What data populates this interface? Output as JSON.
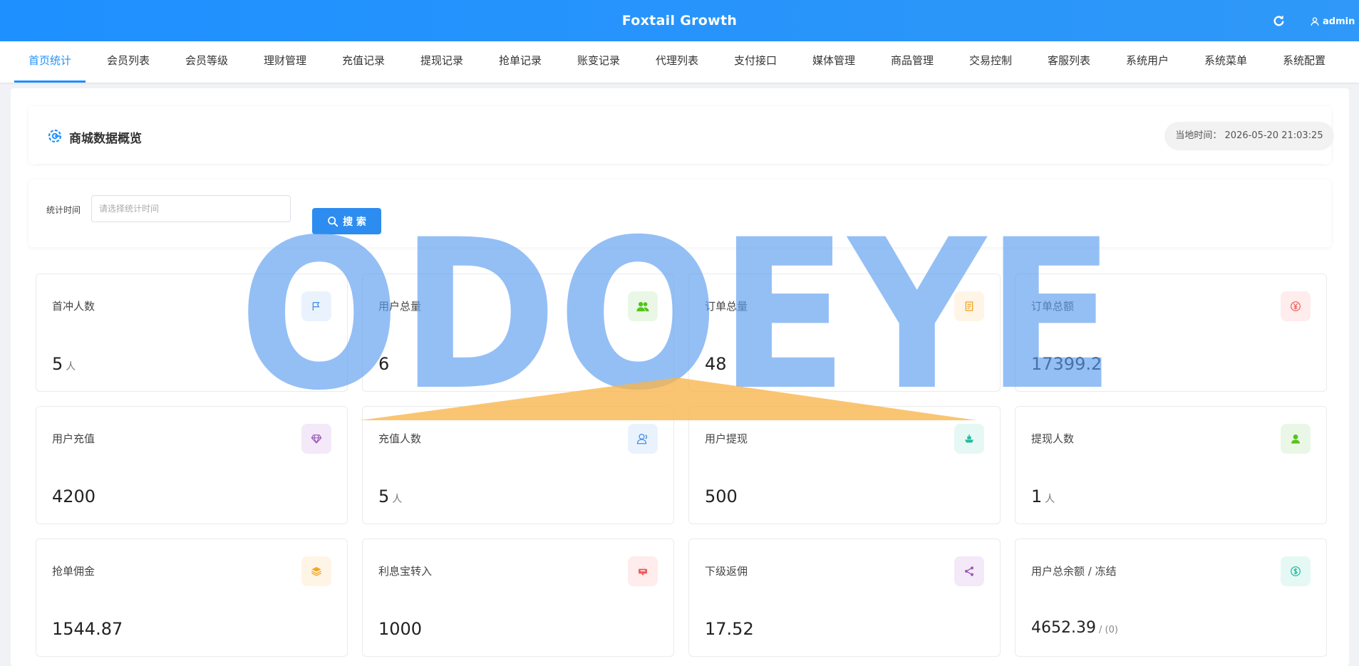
{
  "app": {
    "title": "Foxtail Growth",
    "user": "admin"
  },
  "nav": {
    "tabs": [
      {
        "label": "首页统计",
        "active": true
      },
      {
        "label": "会员列表"
      },
      {
        "label": "会员等级"
      },
      {
        "label": "理财管理"
      },
      {
        "label": "充值记录"
      },
      {
        "label": "提现记录"
      },
      {
        "label": "抢单记录"
      },
      {
        "label": "账变记录"
      },
      {
        "label": "代理列表"
      },
      {
        "label": "支付接口"
      },
      {
        "label": "媒体管理"
      },
      {
        "label": "商品管理"
      },
      {
        "label": "交易控制"
      },
      {
        "label": "客服列表"
      },
      {
        "label": "系统用户"
      },
      {
        "label": "系统菜单"
      },
      {
        "label": "系统配置"
      }
    ]
  },
  "overview": {
    "title": "商城数据概览",
    "time_label": "当地时间：",
    "time_value": "2026-05-20 21:03:25"
  },
  "filter": {
    "label": "统计时间",
    "placeholder": "请选择统计时间",
    "search_label": "搜 索"
  },
  "stats": [
    {
      "label": "首冲人数",
      "value": "5",
      "unit": "人",
      "icon": "flag-icon",
      "accent": "#4a90e2",
      "tint": "#eaf3fd"
    },
    {
      "label": "用户总量",
      "value": "6",
      "unit": "",
      "icon": "users-icon",
      "accent": "#52c41a",
      "tint": "#eaf7e6"
    },
    {
      "label": "订单总量",
      "value": "48",
      "unit": "",
      "icon": "document-icon",
      "accent": "#f5a623",
      "tint": "#fff5e6"
    },
    {
      "label": "订单总额",
      "value": "17399.2",
      "unit": "",
      "icon": "yen-icon",
      "accent": "#f25c5c",
      "tint": "#ffecec"
    },
    {
      "label": "用户充值",
      "value": "4200",
      "unit": "",
      "icon": "diamond-icon",
      "accent": "#9b59b6",
      "tint": "#f3e9f8"
    },
    {
      "label": "充值人数",
      "value": "5",
      "unit": "人",
      "icon": "user-outline-icon",
      "accent": "#4a90e2",
      "tint": "#eaf3fd"
    },
    {
      "label": "用户提现",
      "value": "500",
      "unit": "",
      "icon": "ship-icon",
      "accent": "#1abc9c",
      "tint": "#e6f8f4"
    },
    {
      "label": "提现人数",
      "value": "1",
      "unit": "人",
      "icon": "user-solid-icon",
      "accent": "#52c41a",
      "tint": "#eaf7e6"
    },
    {
      "label": "抢单佣金",
      "value": "1544.87",
      "unit": "",
      "icon": "layers-icon",
      "accent": "#f5a623",
      "tint": "#fff5e6"
    },
    {
      "label": "利息宝转入",
      "value": "1000",
      "unit": "",
      "icon": "wallet-icon",
      "accent": "#f25c5c",
      "tint": "#ffecec"
    },
    {
      "label": "下级返佣",
      "value": "17.52",
      "unit": "",
      "icon": "share-icon",
      "accent": "#9b59b6",
      "tint": "#f3e9f8"
    },
    {
      "label": "用户总余额 / 冻结",
      "value": "4652.39",
      "sub": "/ (0)",
      "icon": "dollar-icon",
      "accent": "#1abc9c",
      "tint": "#e6f8f4"
    }
  ],
  "watermark": {
    "text": "ODOEYE",
    "color": "#5a9cf0",
    "accent": "#f8b54a"
  }
}
